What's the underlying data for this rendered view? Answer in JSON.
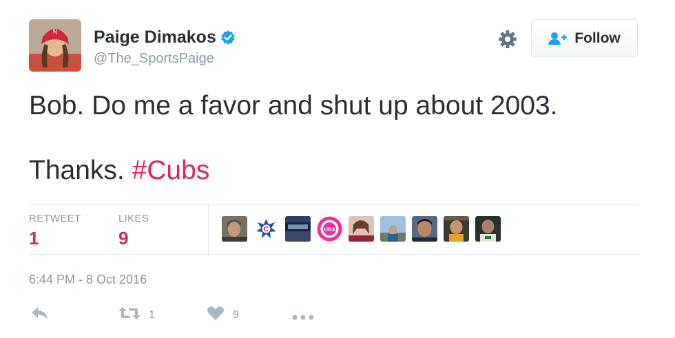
{
  "tweet": {
    "author_name": "Paige Dimakos",
    "author_handle": "@The_SportsPaige",
    "text_line1": "Bob. Do me a favor and shut up about 2003.",
    "text_line2_prefix": "Thanks.",
    "hashtag": "#Cubs",
    "timestamp": "6:44 PM - 8 Oct 2016"
  },
  "header": {
    "follow_label": "Follow"
  },
  "stats": {
    "retweet_label": "RETWEET",
    "retweet_count": "1",
    "likes_label": "LIKES",
    "likes_count": "9"
  },
  "actions": {
    "retweet_count": "1",
    "like_count": "9"
  },
  "colors": {
    "accent": "#e0245e",
    "verified": "#1da1f2",
    "muted": "#8899a6"
  },
  "icons": [
    "verified-icon",
    "gear-icon",
    "follow-person-icon",
    "reply-icon",
    "retweet-icon",
    "heart-icon",
    "more-icon"
  ]
}
